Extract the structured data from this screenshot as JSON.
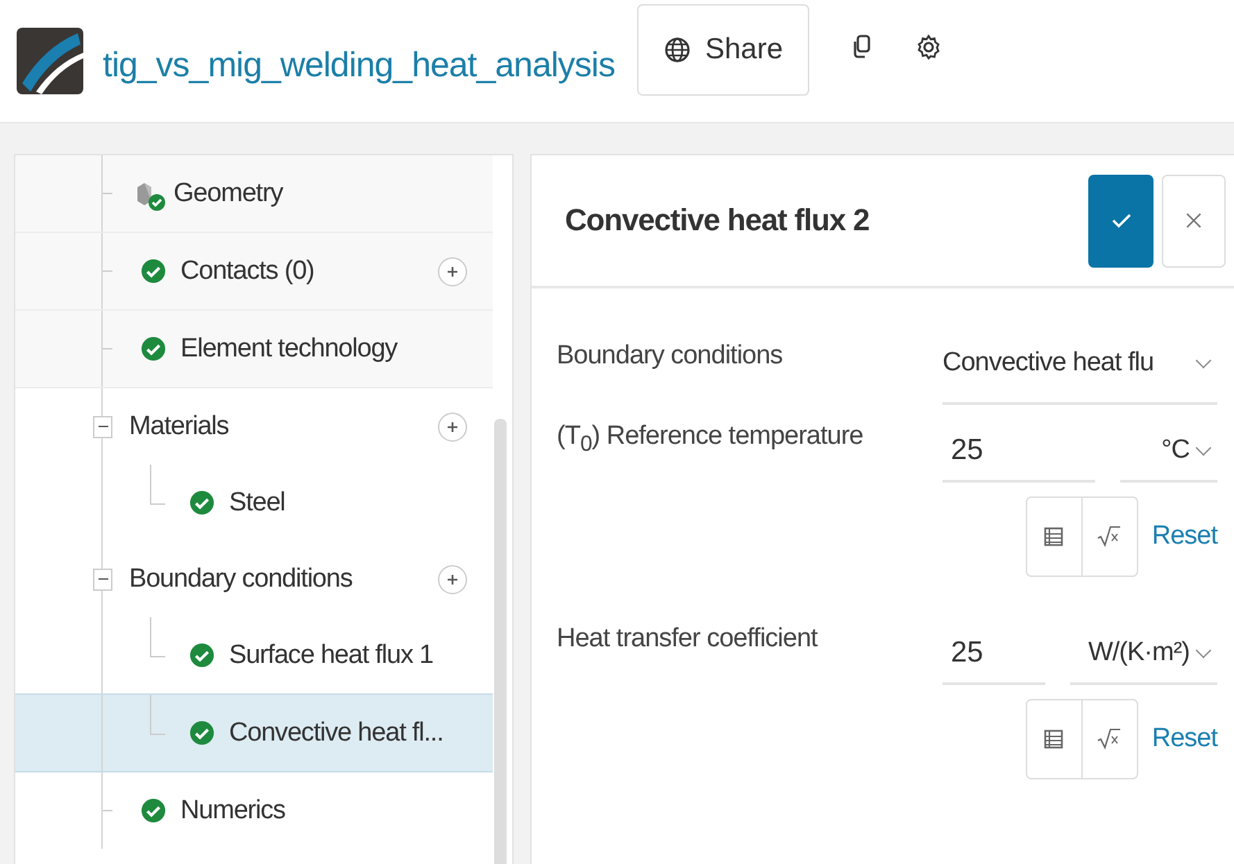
{
  "header": {
    "project_title": "tig_vs_mig_welding_heat_analysis",
    "share_button": "Share"
  },
  "tree": [
    {
      "label": "Geometry",
      "kind": "geometry",
      "addable": false,
      "selected": false
    },
    {
      "label": "Contacts (0)",
      "kind": "check",
      "addable": true,
      "selected": false
    },
    {
      "label": "Element technology",
      "kind": "check",
      "addable": false,
      "selected": false
    },
    {
      "label": "Materials",
      "kind": "group",
      "addable": true,
      "selected": false,
      "expanded": true,
      "children": [
        {
          "label": "Steel",
          "kind": "check",
          "addable": false,
          "selected": false
        }
      ]
    },
    {
      "label": "Boundary conditions",
      "kind": "group",
      "addable": true,
      "selected": false,
      "expanded": true,
      "children": [
        {
          "label": "Surface heat flux 1",
          "kind": "check",
          "addable": false,
          "selected": false
        },
        {
          "label": "Convective heat fl...",
          "kind": "check",
          "addable": false,
          "selected": true
        }
      ]
    },
    {
      "label": "Numerics",
      "kind": "check",
      "addable": false,
      "selected": false
    }
  ],
  "panel": {
    "title": "Convective heat flux 2",
    "fields": [
      {
        "kind": "select",
        "label": "Boundary conditions",
        "value": "Convective heat flu"
      },
      {
        "kind": "quantity",
        "label": "(T$_{0}$) Reference temperature",
        "value": "25",
        "unit": "°C",
        "reset": "Reset"
      },
      {
        "kind": "quantity",
        "label": "Heat transfer coefficient",
        "value": "25",
        "unit": "W/(K·m²)",
        "reset": "Reset"
      }
    ]
  }
}
